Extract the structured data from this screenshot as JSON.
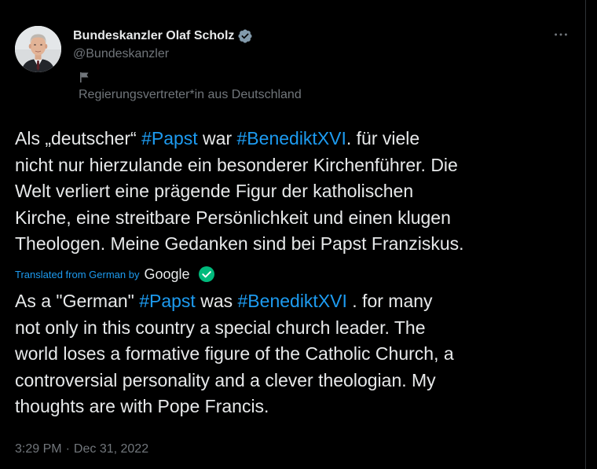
{
  "author": {
    "display_name": "Bundeskanzler Olaf Scholz",
    "handle": "@Bundeskanzler",
    "affiliation_label": "Regierungsvertreter*in aus Deutschland",
    "avatar_icon": "person-photo",
    "verified_icon": "verified-badge-icon",
    "verified_color": "#829aab"
  },
  "menu": {
    "more_icon": "more-horizontal-icon"
  },
  "tweet": {
    "lines": [
      {
        "pre": "Als „deutscher“ ",
        "tag1": "#Papst",
        "mid": " war ",
        "tag2": "#BenediktXVI",
        "post": ". für viele"
      },
      {
        "text": "nicht nur hierzulande ein besonderer Kirchenführer. Die"
      },
      {
        "text": "Welt verliert eine prägende Figur der katholischen"
      },
      {
        "text": "Kirche, eine streitbare Persönlichkeit und einen klugen"
      },
      {
        "text": "Theologen. Meine Gedanken sind bei Papst Franziskus."
      }
    ]
  },
  "translation": {
    "label": "Translated from German by",
    "provider": "Google",
    "lines": [
      {
        "pre": "As a \"German\" ",
        "tag1": "#Papst",
        "mid": " was ",
        "tag2": "#BenediktXVI",
        "post": " . for many"
      },
      {
        "text": "not only in this country a special church leader. The"
      },
      {
        "text": "world loses a formative figure of the Catholic Church, a"
      },
      {
        "text": "controversial personality and a clever theologian. My"
      },
      {
        "text": "thoughts are with Pope Francis."
      }
    ]
  },
  "meta": {
    "time": "3:29 PM",
    "separator": "·",
    "date": "Dec 31, 2022"
  },
  "colors": {
    "background": "#000000",
    "text": "#e7e9ea",
    "muted": "#71767b",
    "link": "#1d9bf0",
    "check_green": "#00ba7c"
  }
}
